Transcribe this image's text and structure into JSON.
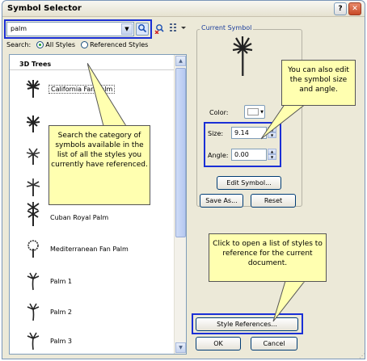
{
  "window": {
    "title": "Symbol Selector"
  },
  "search": {
    "value": "palm",
    "label": "Search:",
    "opt_all": "All Styles",
    "opt_ref": "Referenced Styles"
  },
  "list": {
    "group_title": "3D Trees",
    "items": [
      {
        "label": "California Fan Palm"
      },
      {
        "label": ""
      },
      {
        "label": ""
      },
      {
        "label": ""
      },
      {
        "label": ""
      },
      {
        "label": "Cuban Royal Palm"
      },
      {
        "label": "Mediterranean Fan Palm"
      },
      {
        "label": "Palm 1"
      },
      {
        "label": "Palm 2"
      },
      {
        "label": "Palm 3"
      }
    ]
  },
  "current": {
    "section_label": "Current Symbol",
    "color_label": "Color:",
    "size_label": "Size:",
    "size_value": "9.14",
    "angle_label": "Angle:",
    "angle_value": "0.00",
    "edit_btn": "Edit Symbol...",
    "saveas_btn": "Save As...",
    "reset_btn": "Reset"
  },
  "footer": {
    "style_refs_btn": "Style References...",
    "ok_btn": "OK",
    "cancel_btn": "Cancel"
  },
  "callouts": {
    "search": "Search the category of symbols available in the list of all the styles you currently have referenced.",
    "size": "You can also edit the symbol size and angle.",
    "styles": "Click to open a list of styles to reference for the current document."
  },
  "colors": {
    "highlight": "#1a2fd6",
    "callout_bg": "#ffffb0"
  },
  "icons": {
    "search_button": "magnifier-icon",
    "reset_search": "clear-search-icon",
    "view_options": "list-view-icon"
  }
}
